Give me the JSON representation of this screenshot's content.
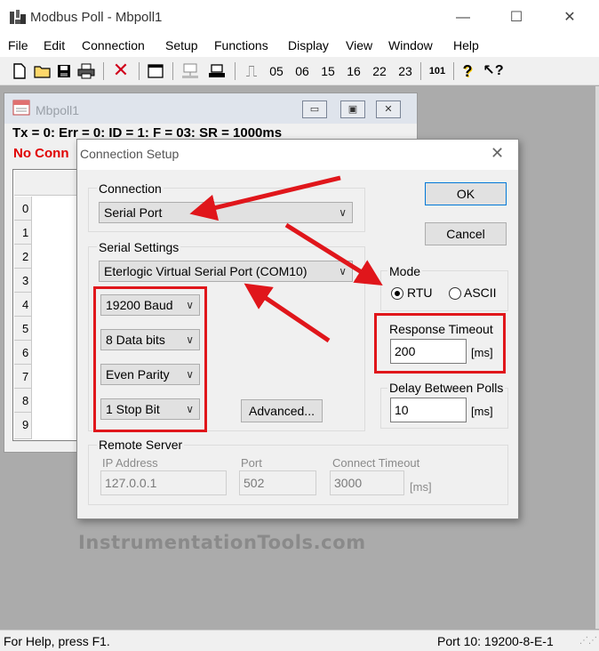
{
  "window": {
    "title": "Modbus Poll - Mbpoll1"
  },
  "menu": [
    "File",
    "Edit",
    "Connection",
    "Setup",
    "Functions",
    "Display",
    "View",
    "Window",
    "Help"
  ],
  "toolbar": {
    "codes": [
      "05",
      "06",
      "15",
      "16",
      "22",
      "23"
    ],
    "btn101": "101"
  },
  "child": {
    "title": "Mbpoll1",
    "status": "Tx = 0: Err = 0: ID = 1: F = 03: SR = 1000ms",
    "no_connection": "No Conn",
    "rows": [
      "0",
      "1",
      "2",
      "3",
      "4",
      "5",
      "6",
      "7",
      "8",
      "9"
    ]
  },
  "dialog": {
    "title": "Connection Setup",
    "connection_label": "Connection",
    "connection_value": "Serial Port",
    "serial_settings_label": "Serial Settings",
    "port_value": "Eterlogic Virtual Serial Port (COM10)",
    "baud": "19200 Baud",
    "data_bits": "8 Data bits",
    "parity": "Even Parity",
    "stop_bits": "1 Stop Bit",
    "advanced_label": "Advanced...",
    "ok_label": "OK",
    "cancel_label": "Cancel",
    "mode_label": "Mode",
    "mode_rtu": "RTU",
    "mode_ascii": "ASCII",
    "mode_selected": "RTU",
    "response_timeout_label": "Response Timeout",
    "response_timeout_value": "200",
    "response_timeout_unit": "[ms]",
    "delay_label": "Delay Between Polls",
    "delay_value": "10",
    "delay_unit": "[ms]",
    "remote_server_label": "Remote Server",
    "ip_label": "IP Address",
    "ip_value": "127.0.0.1",
    "port_label": "Port",
    "port_value_num": "502",
    "connect_timeout_label": "Connect Timeout",
    "connect_timeout_value": "3000",
    "connect_timeout_unit": "[ms]"
  },
  "watermark": "InstrumentationTools.com",
  "statusbar": {
    "left": "For Help, press F1.",
    "right": "Port 10: 19200-8-E-1"
  },
  "colors": {
    "annotation_red": "#e0161b",
    "no_connection_red": "#e00000"
  }
}
